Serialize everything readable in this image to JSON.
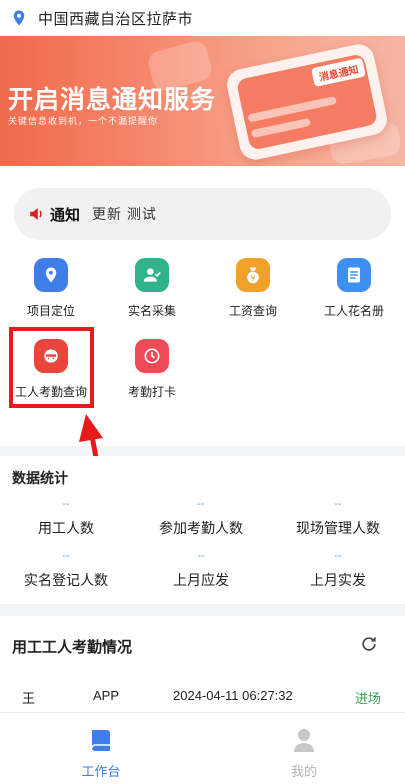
{
  "location": {
    "text": "中国西藏自治区拉萨市",
    "icon": "map-pin-icon"
  },
  "banner": {
    "title": "开启消息通知服务",
    "subtitle": "关键信息收到机，一个不漏提醒你",
    "phone_tag": "消息通知"
  },
  "notice": {
    "label": "通知",
    "text": "更新 测试",
    "icon": "speaker-icon"
  },
  "grid": [
    {
      "label": "项目定位",
      "icon": "location-icon",
      "color": "#3f7ee8"
    },
    {
      "label": "实名采集",
      "icon": "user-check-icon",
      "color": "#2fb38a"
    },
    {
      "label": "工资查询",
      "icon": "money-bag-icon",
      "color": "#f0a22a"
    },
    {
      "label": "工人花名册",
      "icon": "roster-icon",
      "color": "#3d8ff2"
    },
    {
      "label": "工人考勤查询",
      "icon": "attendance-face-icon",
      "color": "#e8453d"
    },
    {
      "label": "考勤打卡",
      "icon": "clock-icon",
      "color": "#ee4a57"
    }
  ],
  "stats": {
    "title": "数据统计",
    "items": [
      {
        "value": "--",
        "label": "用工人数"
      },
      {
        "value": "--",
        "label": "参加考勤人数"
      },
      {
        "value": "--",
        "label": "现场管理人数"
      },
      {
        "value": "--",
        "label": "实名登记人数"
      },
      {
        "value": "--",
        "label": "上月应发"
      },
      {
        "value": "--",
        "label": "上月实发"
      }
    ]
  },
  "records": {
    "title": "用工工人考勤情况",
    "rows": [
      {
        "name": "王",
        "source": "APP",
        "time": "2024-04-11 06:27:32",
        "status": "进场"
      }
    ]
  },
  "tabbar": {
    "items": [
      {
        "label": "工作台",
        "icon": "workbench-icon",
        "active": true
      },
      {
        "label": "我的",
        "icon": "profile-icon",
        "active": false
      }
    ],
    "active_color": "#3f7ee8",
    "inactive_color": "#b5b5b5"
  }
}
